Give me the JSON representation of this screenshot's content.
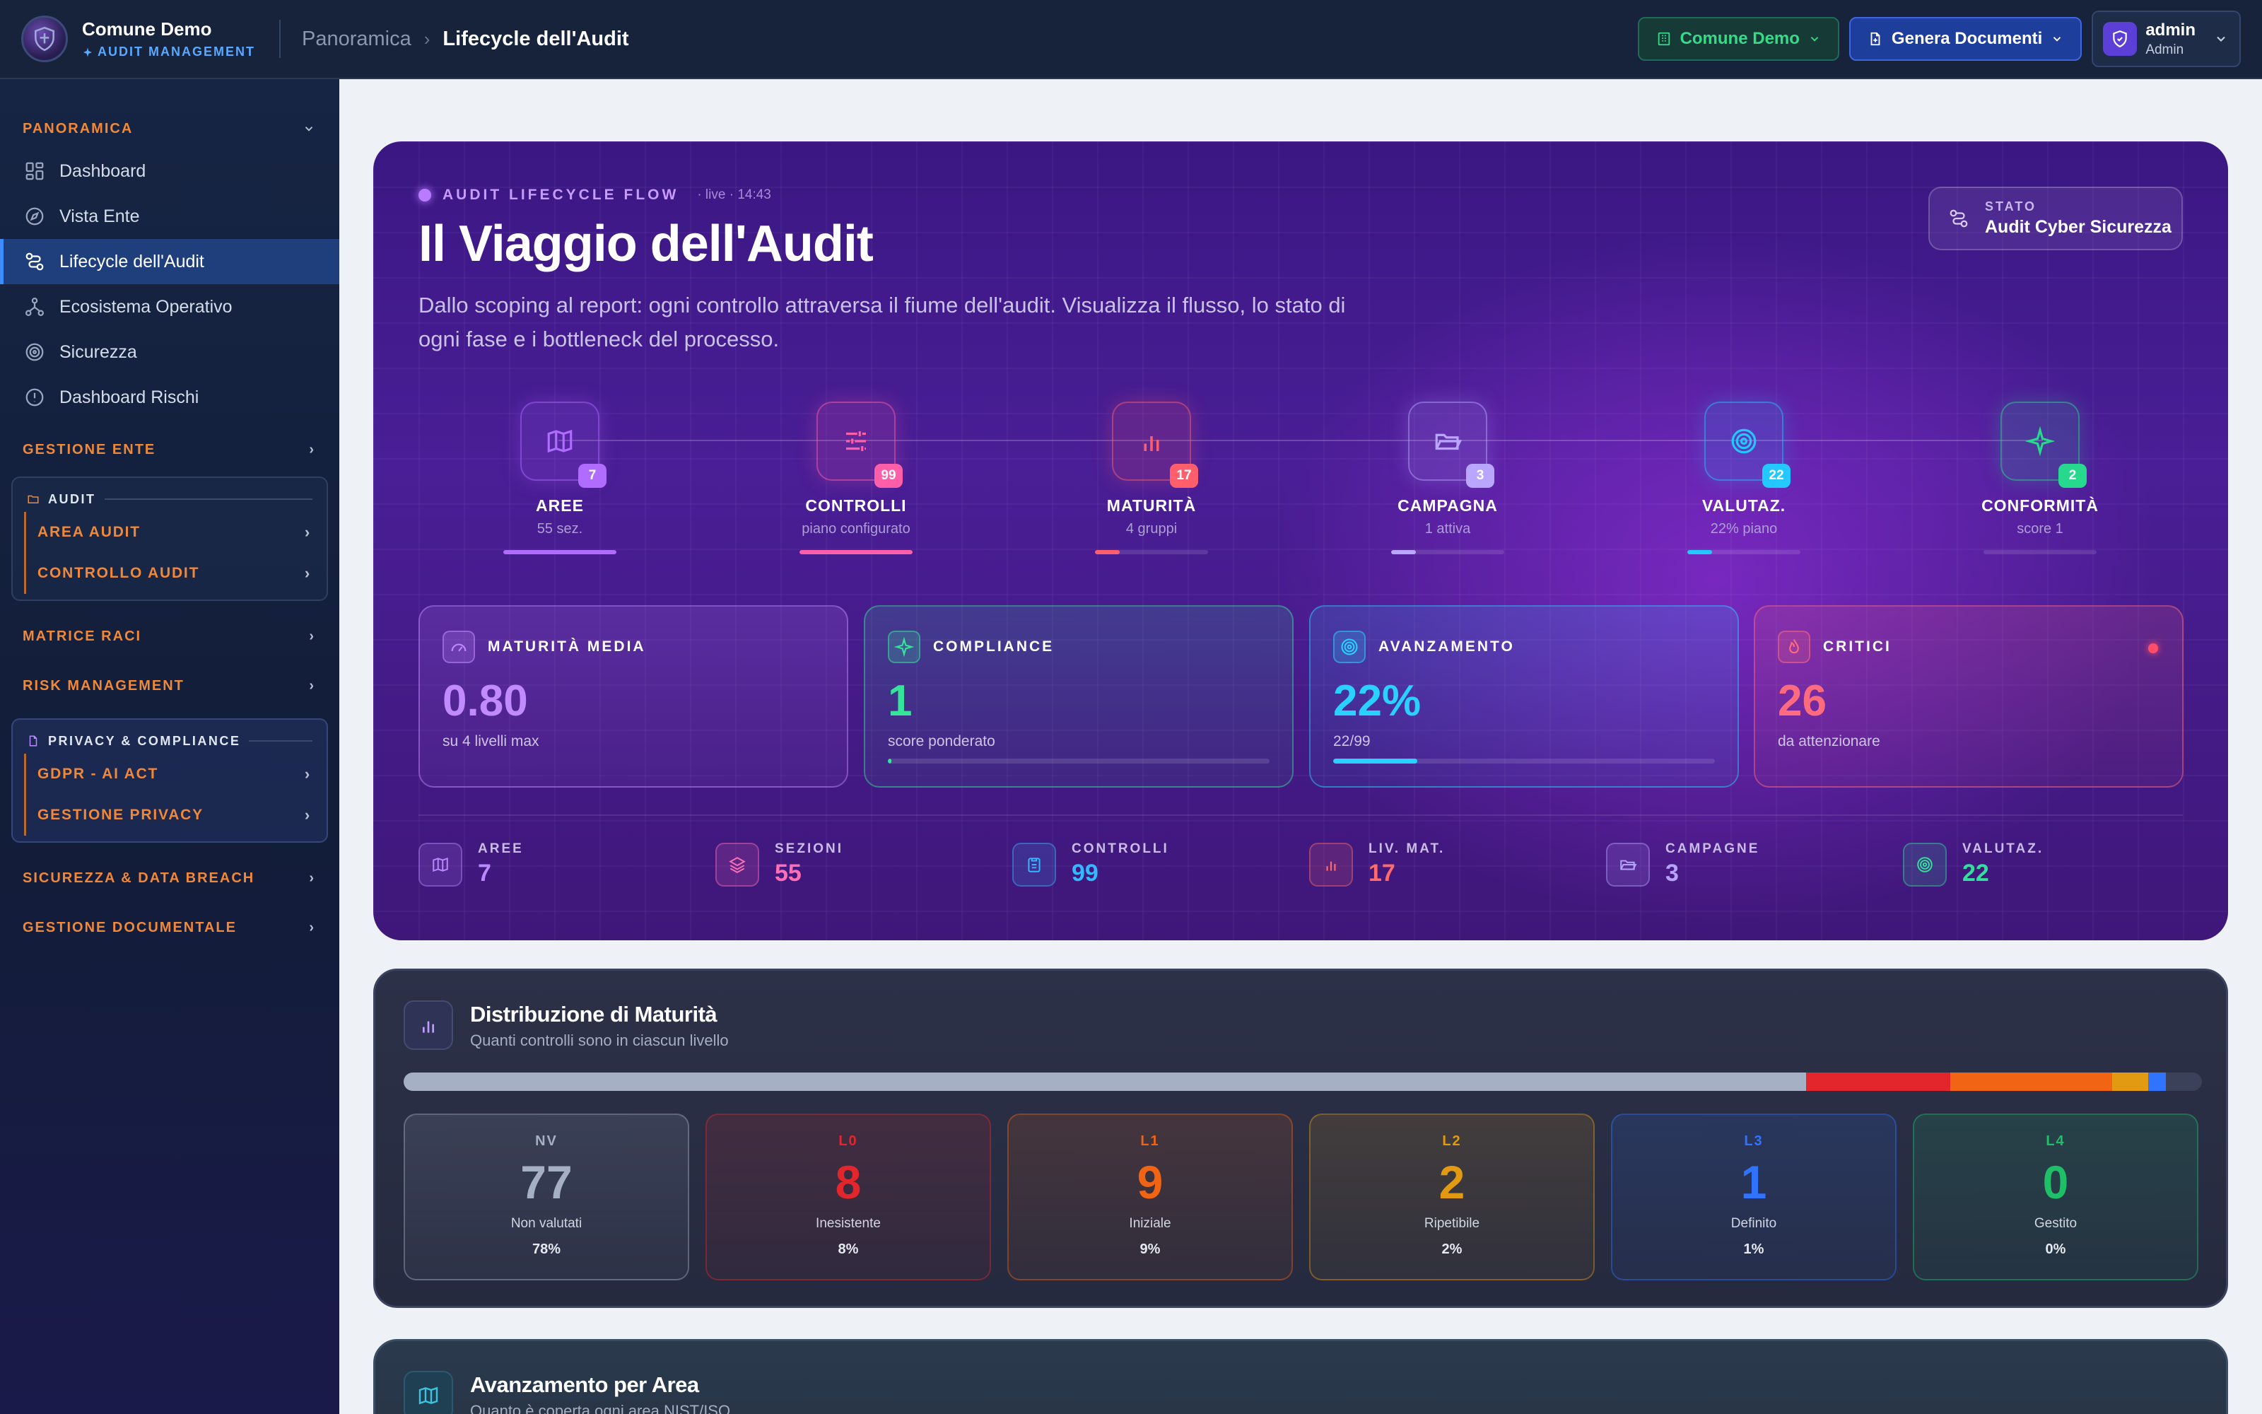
{
  "header": {
    "brand_name": "Comune Demo",
    "brand_sub": "AUDIT MANAGEMENT",
    "breadcrumb": [
      "Panoramica",
      "Lifecycle dell'Audit"
    ],
    "comune_button": "Comune Demo",
    "genera_button": "Genera Documenti",
    "user_name": "admin",
    "user_role": "Admin"
  },
  "sidebar": {
    "panoramica_label": "PANORAMICA",
    "items": [
      {
        "label": "Dashboard",
        "icon": "grid-icon"
      },
      {
        "label": "Vista Ente",
        "icon": "compass-icon"
      },
      {
        "label": "Lifecycle dell'Audit",
        "icon": "route-icon",
        "active": true
      },
      {
        "label": "Ecosistema Operativo",
        "icon": "network-icon"
      },
      {
        "label": "Sicurezza",
        "icon": "radar-icon"
      },
      {
        "label": "Dashboard Rischi",
        "icon": "alert-circle-icon"
      }
    ],
    "gestione_ente": "GESTIONE ENTE",
    "audit_group": {
      "title": "AUDIT",
      "items": [
        "AREA AUDIT",
        "CONTROLLO AUDIT"
      ]
    },
    "matrice_raci": "MATRICE RACI",
    "risk_management": "RISK MANAGEMENT",
    "privacy_group": {
      "title": "PRIVACY & COMPLIANCE",
      "items": [
        "GDPR - AI ACT",
        "GESTIONE PRIVACY"
      ]
    },
    "sicurezza_breach": "SICUREZZA & DATA BREACH",
    "gestione_doc": "GESTIONE DOCUMENTALE"
  },
  "hero": {
    "kicker": "AUDIT LIFECYCLE FLOW",
    "live": "· live · 14:43",
    "title": "Il Viaggio dell'Audit",
    "description": "Dallo scoping al report: ogni controllo attraversa il fiume dell'audit. Visualizza il flusso, lo stato di ogni fase e i bottleneck del processo.",
    "state_label": "STATO",
    "state_value": "Audit Cyber Sicurezza",
    "stages": [
      {
        "name": "AREE",
        "sub": "55 sez.",
        "count": "7",
        "progress": 1.0,
        "color": "#b06cff",
        "icon": "map-icon"
      },
      {
        "name": "CONTROLLI",
        "sub": "piano configurato",
        "count": "99",
        "progress": 1.0,
        "color": "#ff5fa8",
        "icon": "sliders-icon"
      },
      {
        "name": "MATURITÀ",
        "sub": "4 gruppi",
        "count": "17",
        "progress": 0.22,
        "color": "#ff5f6d",
        "icon": "bar-chart-icon"
      },
      {
        "name": "CAMPAGNA",
        "sub": "1 attiva",
        "count": "3",
        "progress": 0.22,
        "color": "#b9a7ff",
        "icon": "folder-open-icon"
      },
      {
        "name": "VALUTAZ.",
        "sub": "22% piano",
        "count": "22",
        "progress": 0.22,
        "color": "#22c8ff",
        "icon": "target-icon"
      },
      {
        "name": "CONFORMITÀ",
        "sub": "score 1",
        "count": "2",
        "progress": 0.0,
        "color": "#27d98d",
        "icon": "sparkle-icon"
      }
    ],
    "kpis": [
      {
        "label": "MATURITÀ MEDIA",
        "value": "0.80",
        "sub": "su 4 livelli max",
        "color": "#c18bff",
        "icon": "gauge-icon"
      },
      {
        "label": "COMPLIANCE",
        "value": "1",
        "sub": "score ponderato",
        "color": "#35e39b",
        "icon": "sparkle-icon",
        "progress": 0.01
      },
      {
        "label": "AVANZAMENTO",
        "value": "22%",
        "sub": "22/99",
        "color": "#2ad0ff",
        "icon": "target-icon",
        "progress": 0.22
      },
      {
        "label": "CRITICI",
        "value": "26",
        "sub": "da attenzionare",
        "color": "#ff6b7e",
        "icon": "flame-icon"
      }
    ],
    "minis": [
      {
        "label": "AREE",
        "value": "7",
        "color": "#b98aff",
        "icon": "map-icon"
      },
      {
        "label": "SEZIONI",
        "value": "55",
        "color": "#ff6fb5",
        "icon": "layers-icon"
      },
      {
        "label": "CONTROLLI",
        "value": "99",
        "color": "#35b8ff",
        "icon": "clipboard-icon"
      },
      {
        "label": "LIV. MAT.",
        "value": "17",
        "color": "#ff6b6b",
        "icon": "bar-chart-icon"
      },
      {
        "label": "CAMPAGNE",
        "value": "3",
        "color": "#b5a4ff",
        "icon": "folder-open-icon"
      },
      {
        "label": "VALUTAZ.",
        "value": "22",
        "color": "#33e09b",
        "icon": "target-icon"
      }
    ]
  },
  "distribution": {
    "title": "Distribuzione di Maturità",
    "subtitle": "Quanti controlli sono in ciascun livello",
    "levels": [
      {
        "code": "NV",
        "count": "77",
        "name": "Non valutati",
        "pct": "78%",
        "color": "#a6b0c4",
        "share": 0.78
      },
      {
        "code": "L0",
        "count": "8",
        "name": "Inesistente",
        "pct": "8%",
        "color": "#e2262b",
        "share": 0.08
      },
      {
        "code": "L1",
        "count": "9",
        "name": "Iniziale",
        "pct": "9%",
        "color": "#f06414",
        "share": 0.09
      },
      {
        "code": "L2",
        "count": "2",
        "name": "Ripetibile",
        "pct": "2%",
        "color": "#e39a13",
        "share": 0.02
      },
      {
        "code": "L3",
        "count": "1",
        "name": "Definito",
        "pct": "1%",
        "color": "#2f73ff",
        "share": 0.01
      },
      {
        "code": "L4",
        "count": "0",
        "name": "Gestito",
        "pct": "0%",
        "color": "#1fbf68",
        "share": 0.0
      }
    ]
  },
  "area_card": {
    "title": "Avanzamento per Area",
    "subtitle": "Quanto è coperta ogni area NIST/ISO"
  }
}
